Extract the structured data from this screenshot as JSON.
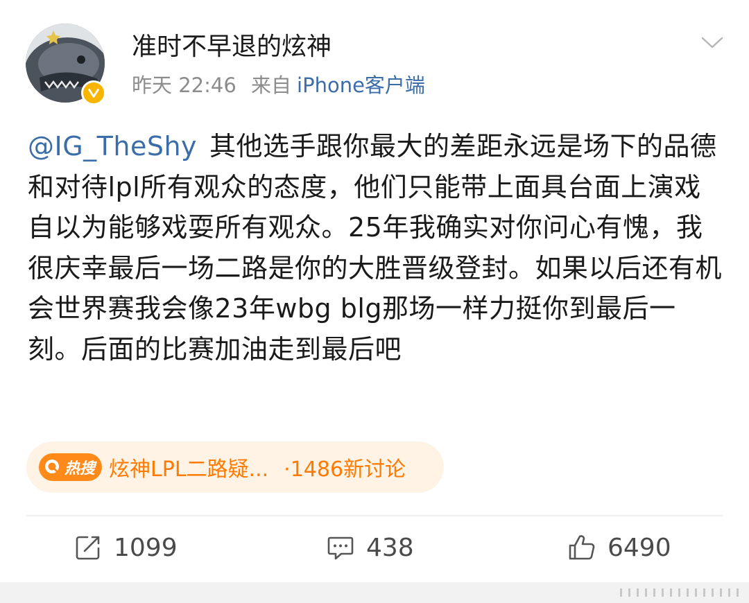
{
  "post": {
    "username": "准时不早退的炫神",
    "time": "昨天 22:46",
    "source_prefix": "来自",
    "source": "iPhone客户端",
    "verified_badge": "verified-yellow-v",
    "mention": "@IG_TheShy",
    "text": "其他选手跟你最大的差距永远是场下的品德和对待lpl所有观众的态度，他们只能带上面具台面上演戏自以为能够戏耍所有观众。25年我确实对你问心有愧，我很庆幸最后一场二路是你的大胜晋级登封。如果以后还有机会世界赛我会像23年wbg blg那场一样力挺你到最后一刻。后面的比赛加油走到最后吧"
  },
  "hot_search": {
    "badge_label": "热搜",
    "topic": "炫神LPL二路疑...",
    "count": "·1486新讨论",
    "color": "#ff7a00"
  },
  "actions": {
    "repost_count": "1099",
    "comment_count": "438",
    "like_count": "6490"
  },
  "colors": {
    "link": "#3b6ea8",
    "meta": "#8c8c8c",
    "badge": "#f7b500"
  }
}
